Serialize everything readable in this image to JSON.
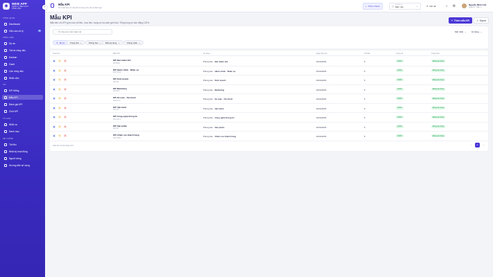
{
  "sidebar": {
    "app_name": "WEB APP",
    "app_sub": "QUẢN LÝ HIỆU SUẤT CÔNG VIỆC",
    "collapse_icon": "chevron-left-icon",
    "sections": [
      {
        "title": "TỔNG QUAN"
      },
      {
        "title": "CÔNG VIỆC"
      },
      {
        "title": "KPI"
      },
      {
        "title": "TÀI SẢN"
      },
      {
        "title": "HỆ THỐNG"
      }
    ],
    "items": [
      {
        "label": "Dashboard",
        "icon": "grid-icon"
      },
      {
        "label": "Việc cần xử lý",
        "icon": "inbox-icon",
        "badge": "3"
      },
      {
        "label": "Dự án",
        "icon": "folder-icon"
      },
      {
        "label": "Tất cả công việc",
        "icon": "list-icon"
      },
      {
        "label": "Kanban",
        "icon": "kanban-icon"
      },
      {
        "label": "Gantt",
        "icon": "gantt-icon"
      },
      {
        "label": "Lịch công việc",
        "icon": "calendar-icon"
      },
      {
        "label": "Nhắc việc",
        "icon": "bell-icon"
      },
      {
        "label": "KPI thắng",
        "icon": "chart-icon"
      },
      {
        "label": "Mẫu KPI",
        "icon": "template-icon"
      },
      {
        "label": "Đánh giá KPI",
        "icon": "star-icon"
      },
      {
        "label": "Chốt KPI",
        "icon": "check-icon"
      },
      {
        "label": "Nhắc vụ",
        "icon": "tag-icon"
      },
      {
        "label": "Danh mục",
        "icon": "box-icon"
      },
      {
        "label": "Tài liệu",
        "icon": "file-icon"
      },
      {
        "label": "Nhật ký hoạt động",
        "icon": "history-icon"
      },
      {
        "label": "Người dùng",
        "icon": "users-icon"
      },
      {
        "label": "Hướng dẫn sử dụng",
        "icon": "help-icon"
      }
    ]
  },
  "topbar": {
    "page_name": "Mẫu KPI",
    "page_desc": "Thư viện tiêu chí mẫu để sử dụng cho các kỳ đánh giá",
    "quick_add": "Thêm nhanh",
    "period_label": "Kỳ hiện tại",
    "period_value": "Năm nay",
    "connected": "Kết nối",
    "notif_count": "2",
    "user_name": "Nguyễn Minh Anh",
    "user_role": "Quản trị · Cấp 1"
  },
  "main": {
    "title": "Mẫu KPI",
    "description": "Mẫu tiêu chí KPI gồm các chỉ tiêu, mục tiêu, trọng số và cách giới hạn. Tổng trọng số cần bằng 100%.",
    "add_button": "Thêm mẫu KPI",
    "export_button": "Export"
  },
  "filters": {
    "search_placeholder": "Tìm theo tên mẫu hoặc mã",
    "sort_label": "Mới nhất",
    "view_label": "10 dòng",
    "chips": [
      "Bộ lọc",
      "Trạng thái",
      "Phòng ban",
      "Mẫu áp dụng",
      "Không nhận"
    ]
  },
  "table": {
    "columns": [
      "Thao tác",
      "Mẫu KPI",
      "Áp dụng",
      "Ngày hiệu lực",
      "Chỉ tiêu",
      "Trọng số",
      "Trạng thái"
    ],
    "rows": [
      {
        "name": "KPI Ban Giám đốc",
        "code": "KPI-BGD",
        "dept_prefix": "Phòng ban ·",
        "dept": "Ban Giám đốc",
        "date": "01/01/2026",
        "count": "5",
        "weight": "100%",
        "status": "Đang áp dụng"
      },
      {
        "name": "KPI Hành chính - Nhân sự",
        "code": "KPI-HCNS",
        "dept_prefix": "Phòng ban ·",
        "dept": "Hành chính - Nhân sự",
        "date": "01/01/2026",
        "count": "5",
        "weight": "100%",
        "status": "Đang áp dụng"
      },
      {
        "name": "KPI Kinh doanh",
        "code": "KPI-KD",
        "dept_prefix": "Phòng ban ·",
        "dept": "Kinh doanh",
        "date": "01/01/2026",
        "count": "5",
        "weight": "100%",
        "status": "Đang áp dụng"
      },
      {
        "name": "KPI Marketing",
        "code": "KPI-MKT",
        "dept_prefix": "Phòng ban ·",
        "dept": "Marketing",
        "date": "01/01/2026",
        "count": "5",
        "weight": "100%",
        "status": "Đang áp dụng"
      },
      {
        "name": "KPI Kế toán - Tài chính",
        "code": "KPI-KTTC",
        "dept_prefix": "Phòng ban ·",
        "dept": "Kế toán - Tài chính",
        "date": "01/01/2026",
        "count": "5",
        "weight": "100%",
        "status": "Đang áp dụng"
      },
      {
        "name": "KPI Vận hành",
        "code": "KPI-VH",
        "dept_prefix": "Phòng ban ·",
        "dept": "Vận hành",
        "date": "01/01/2026",
        "count": "5",
        "weight": "100%",
        "status": "Đang áp dụng"
      },
      {
        "name": "KPI Công nghệ thông tin",
        "code": "KPI-CNTT",
        "dept_prefix": "Phòng ban ·",
        "dept": "Công nghệ thông tin",
        "date": "01/01/2026",
        "count": "5",
        "weight": "100%",
        "status": "Đang áp dụng"
      },
      {
        "name": "KPI Sản phẩm",
        "code": "KPI-SP",
        "dept_prefix": "Phòng ban ·",
        "dept": "Sản phẩm",
        "date": "01/01/2026",
        "count": "5",
        "weight": "100%",
        "status": "Đang áp dụng"
      },
      {
        "name": "KPI Chăm sóc khách hàng",
        "code": "KPI-CSKH",
        "dept_prefix": "Phòng ban ·",
        "dept": "Chăm sóc khách hàng",
        "date": "01/01/2026",
        "count": "5",
        "weight": "100%",
        "status": "Đang áp dụng"
      }
    ],
    "footer": "Hiển thị 1-9 trên tổng số 9",
    "current_page": "1"
  }
}
